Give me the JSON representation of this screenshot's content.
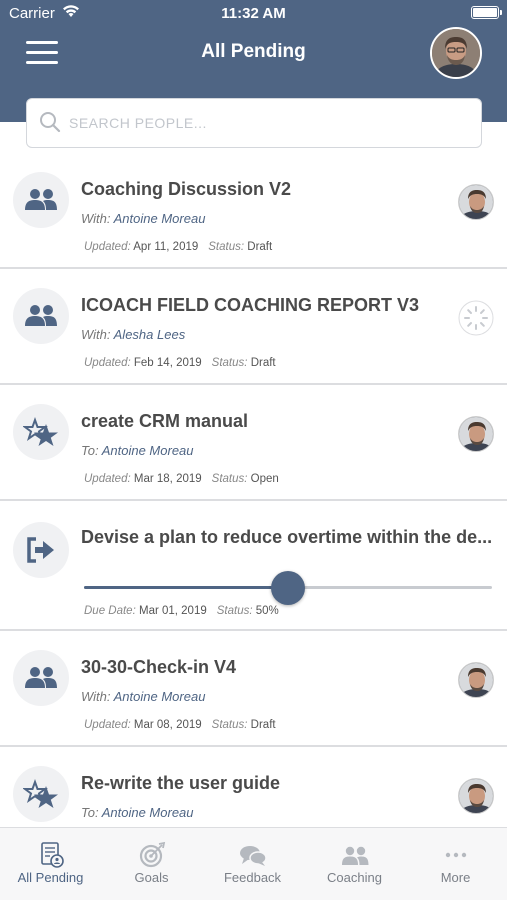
{
  "status_bar": {
    "carrier": "Carrier",
    "time": "11:32 AM"
  },
  "header": {
    "title": "All Pending"
  },
  "search": {
    "placeholder": "SEARCH PEOPLE..."
  },
  "items": [
    {
      "title": "Coaching Discussion V2",
      "with_prefix": "With:",
      "person": "Antoine Moreau",
      "date_label": "Updated:",
      "date": "Apr 11, 2019",
      "status_label": "Status:",
      "status": "Draft",
      "type_icon": "people-icon"
    },
    {
      "title": "ICOACH FIELD COACHING REPORT V3",
      "with_prefix": "With:",
      "person": "Alesha Lees",
      "date_label": "Updated:",
      "date": "Feb 14, 2019",
      "status_label": "Status:",
      "status": "Draft",
      "type_icon": "people-icon"
    },
    {
      "title": "create CRM manual",
      "with_prefix": "To:",
      "person": "Antoine Moreau",
      "date_label": "Updated:",
      "date": "Mar 18, 2019",
      "status_label": "Status:",
      "status": "Open",
      "type_icon": "stars-icon"
    },
    {
      "title": "Devise a plan to reduce overtime within the de...",
      "date_label": "Due Date:",
      "date": "Mar 01, 2019",
      "status_label": "Status:",
      "status": "50%",
      "progress": 0.5,
      "type_icon": "exit-arrow-icon"
    },
    {
      "title": "30-30-Check-in V4",
      "with_prefix": "With:",
      "person": "Antoine Moreau",
      "date_label": "Updated:",
      "date": "Mar 08, 2019",
      "status_label": "Status:",
      "status": "Draft",
      "type_icon": "people-icon"
    },
    {
      "title": "Re-write the user guide",
      "with_prefix": "To:",
      "person": "Antoine Moreau",
      "type_icon": "stars-icon"
    }
  ],
  "tabs": [
    {
      "label": "All Pending",
      "icon": "pending-list-icon",
      "active": true
    },
    {
      "label": "Goals",
      "icon": "target-icon"
    },
    {
      "label": "Feedback",
      "icon": "chat-bubbles-icon"
    },
    {
      "label": "Coaching",
      "icon": "people-icon"
    },
    {
      "label": "More",
      "icon": "more-dots-icon"
    }
  ],
  "colors": {
    "brand": "#4f6584",
    "icon_gray": "#b5b9bf"
  }
}
